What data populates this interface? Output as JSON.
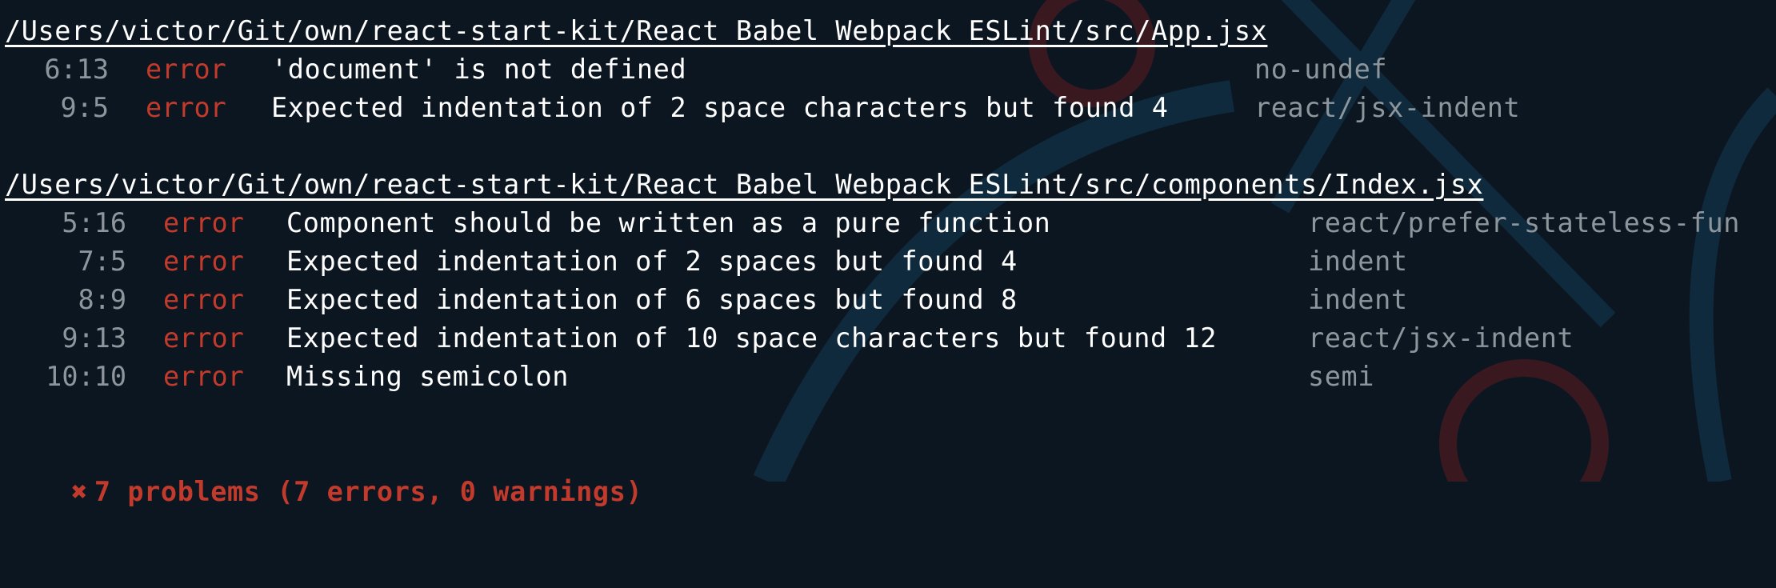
{
  "colors": {
    "background": "#0c1620",
    "text": "#ffffff",
    "muted": "#8d969c",
    "error": "#c23a2c"
  },
  "files": [
    {
      "path": "/Users/victor/Git/own/react-start-kit/React Babel Webpack ESLint/src/App.jsx",
      "problems": [
        {
          "position": "6:13",
          "severity": "error",
          "message": "'document' is not defined",
          "rule": "no-undef"
        },
        {
          "position": "9:5",
          "severity": "error",
          "message": "Expected indentation of 2 space characters but found 4",
          "rule": "react/jsx-indent"
        }
      ]
    },
    {
      "path": "/Users/victor/Git/own/react-start-kit/React Babel Webpack ESLint/src/components/Index.jsx",
      "problems": [
        {
          "position": "5:16",
          "severity": "error",
          "message": "Component should be written as a pure function",
          "rule": "react/prefer-stateless-fun"
        },
        {
          "position": "7:5",
          "severity": "error",
          "message": "Expected indentation of 2 spaces but found 4",
          "rule": "indent"
        },
        {
          "position": "8:9",
          "severity": "error",
          "message": "Expected indentation of 6 spaces but found 8",
          "rule": "indent"
        },
        {
          "position": "9:13",
          "severity": "error",
          "message": "Expected indentation of 10 space characters but found 12",
          "rule": "react/jsx-indent"
        },
        {
          "position": "10:10",
          "severity": "error",
          "message": "Missing semicolon",
          "rule": "semi"
        }
      ]
    }
  ],
  "summary": {
    "icon": "cross-mark-icon",
    "symbol": "✖",
    "text": "7 problems (7 errors, 0 warnings)"
  }
}
